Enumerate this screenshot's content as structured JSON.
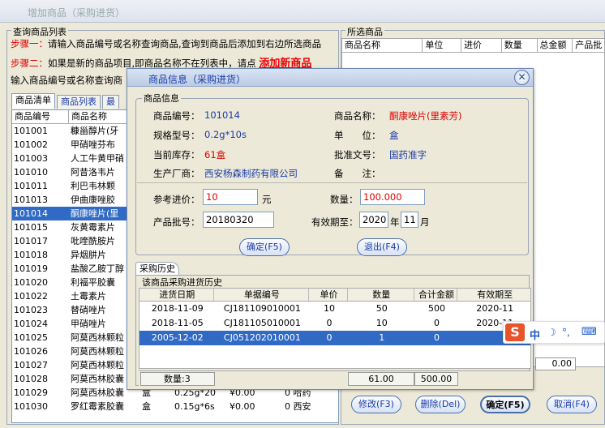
{
  "window": {
    "title": "增加商品（采购进货）"
  },
  "query": {
    "title": "查询商品列表",
    "step1_label": "步骤一：",
    "step1_text": "请输入商品编号或名称查询商品,查询到商品后添加到右边所选商品",
    "step2_label": "步骤二：",
    "step2_text": "如果是新的商品项目,即商品名称不在列表中，请点",
    "add_new_link": "添加新商品",
    "search_label": "输入商品编号或名称查询商",
    "tabs": [
      "商品清单",
      "商品列表",
      "最"
    ],
    "columns": [
      "商品编号",
      "商品名称"
    ],
    "rows": [
      {
        "code": "101001",
        "name": "糠甾醇片(牙"
      },
      {
        "code": "101002",
        "name": "甲硝唑芬布"
      },
      {
        "code": "101003",
        "name": "人工牛黄甲硝"
      },
      {
        "code": "101010",
        "name": "阿昔洛韦片"
      },
      {
        "code": "101011",
        "name": "利巴韦林颗"
      },
      {
        "code": "101013",
        "name": "伊曲康唑胶"
      },
      {
        "code": "101014",
        "name": "酮康唑片(里"
      },
      {
        "code": "101015",
        "name": "灰黄霉素片"
      },
      {
        "code": "101017",
        "name": "吡喹酰胺片"
      },
      {
        "code": "101018",
        "name": "异烟肼片"
      },
      {
        "code": "101019",
        "name": "盐酸乙胺丁醇"
      },
      {
        "code": "101020",
        "name": "利福平胶囊"
      },
      {
        "code": "101022",
        "name": "土霉素片"
      },
      {
        "code": "101023",
        "name": "替硝唑片"
      },
      {
        "code": "101024",
        "name": "甲硝唑片"
      },
      {
        "code": "101025",
        "name": "阿莫西林颗粒"
      },
      {
        "code": "101026",
        "name": "阿莫西林颗粒"
      },
      {
        "code": "101027",
        "name": "阿莫西林颗粒"
      },
      {
        "code": "101028",
        "name": "阿莫西林胶囊"
      },
      {
        "code": "101029",
        "name": "阿莫西林胶囊",
        "unit": "盒",
        "spec": "0.25g*20",
        "price": "¥0.00",
        "ext": "0 哈药"
      },
      {
        "code": "101030",
        "name": "罗红霉素胶囊",
        "unit": "盒",
        "spec": "0.15g*6s",
        "price": "¥0.00",
        "ext": "0 西安"
      }
    ],
    "selected_index": 6
  },
  "selected": {
    "title": "所选商品",
    "columns": [
      "商品名称",
      "单位",
      "进价",
      "数量",
      "总金额",
      "产品批"
    ],
    "total_value": "0.00",
    "buttons": {
      "edit": "修改(F3)",
      "delete": "删除(Del)",
      "ok": "确定(F5)",
      "cancel": "取消(F4)"
    }
  },
  "dialog": {
    "title": "商品信息（采购进货）",
    "info_group": "商品信息",
    "code_label": "商品编号：",
    "code": "101014",
    "name_label": "商品名称：",
    "name": "酮康唑片(里素芳)",
    "spec_label": "规格型号：",
    "spec": "0.2g*10s",
    "unit_label": "单　　位：",
    "unit": "盒",
    "stock_label": "当前库存：",
    "stock": "61盒",
    "approval_label": "批准文号：",
    "approval": "国药准字",
    "maker_label": "生产厂商：",
    "maker": "西安杨森制药有限公司",
    "remark_label": "备　　注：",
    "price_label": "参考进价：",
    "price_value": "10",
    "price_unit": "元",
    "qty_label": "数量：",
    "qty_value": "100.000",
    "batch_label": "产品批号：",
    "batch_value": "20180320",
    "expiry_label": "有效期至：",
    "expiry_year": "2020",
    "year_unit": "年",
    "expiry_month": "11",
    "month_unit": "月",
    "ok_button": "确定(F5)",
    "exit_button": "退出(F4)",
    "history_tab": "采购历史",
    "history_title": "该商品采购进货历史",
    "history_columns": [
      "进货日期",
      "单据编号",
      "单价",
      "数量",
      "合计金额",
      "有效期至"
    ],
    "history_rows": [
      {
        "date": "2018-11-09",
        "doc": "CJ181109010001",
        "price": "10",
        "qty": "50",
        "amount": "500",
        "expiry": "2020-11"
      },
      {
        "date": "2018-11-05",
        "doc": "CJ181105010001",
        "price": "0",
        "qty": "10",
        "amount": "0",
        "expiry": "2020-11"
      },
      {
        "date": "2005-12-02",
        "doc": "CJ051202010001",
        "price": "0",
        "qty": "1",
        "amount": "0",
        "expiry": ""
      }
    ],
    "history_selected": 2,
    "footer_count": "数量:3",
    "footer_qty": "61.00",
    "footer_amount": "500.00"
  },
  "ime": {
    "logo": "S",
    "lang": "中",
    "items": [
      "☽",
      "°,",
      "⌨"
    ]
  }
}
